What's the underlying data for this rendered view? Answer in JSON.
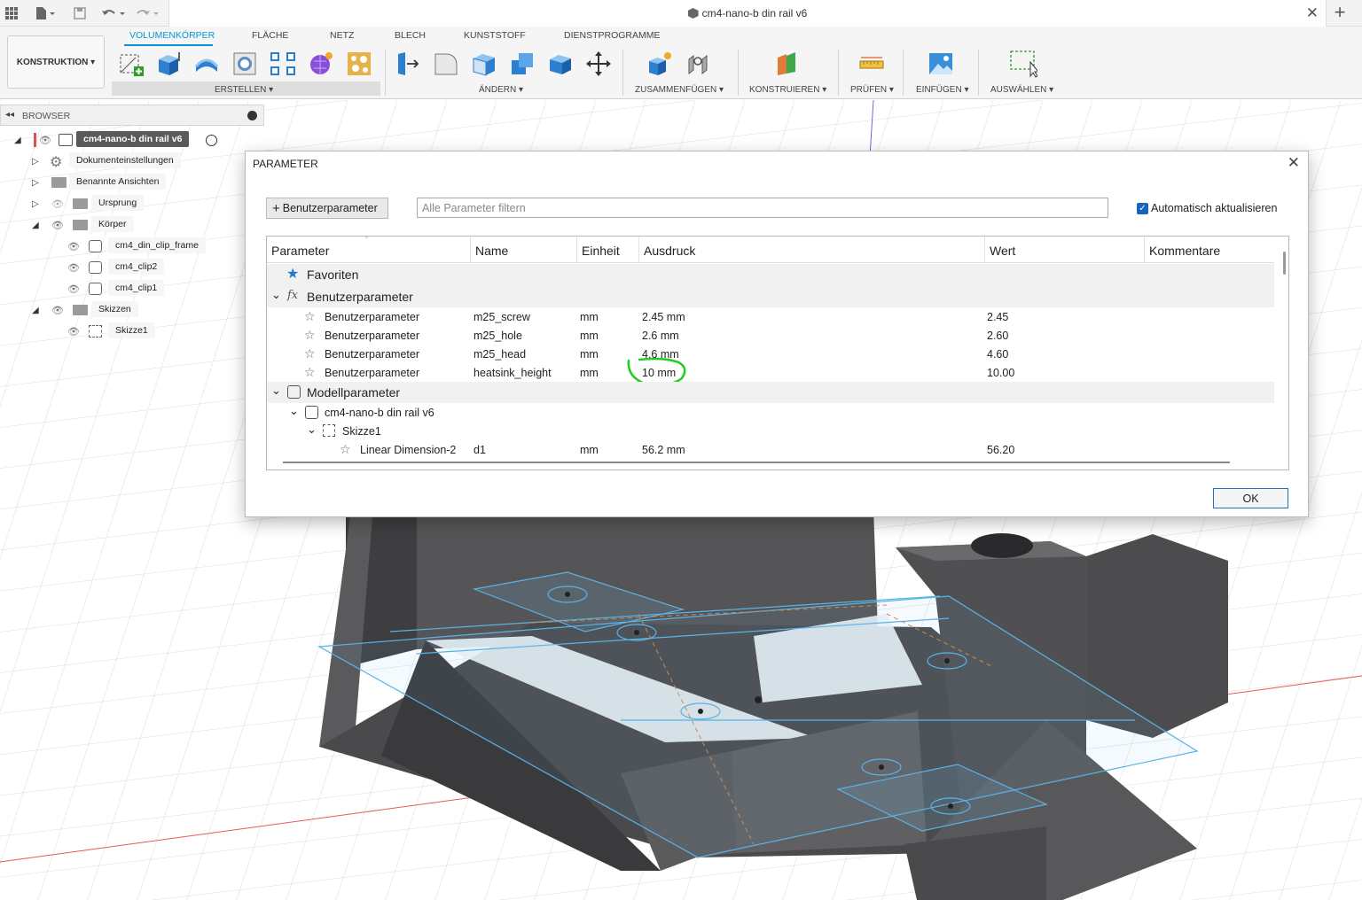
{
  "app": {
    "document_title": "cm4-nano-b din rail v6"
  },
  "ribbon": {
    "workspace": "KONSTRUKTION",
    "tabs": [
      "VOLUMENKÖRPER",
      "FLÄCHE",
      "NETZ",
      "BLECH",
      "KUNSTSTOFF",
      "DIENSTPROGRAMME"
    ],
    "groups": [
      "ERSTELLEN",
      "ÄNDERN",
      "ZUSAMMENFÜGEN",
      "KONSTRUIEREN",
      "PRÜFEN",
      "EINFÜGEN",
      "AUSWÄHLEN"
    ]
  },
  "browser": {
    "title": "BROWSER",
    "root": "cm4-nano-b din rail v6",
    "items": [
      "Dokumenteinstellungen",
      "Benannte Ansichten",
      "Ursprung",
      "Körper",
      "cm4_din_clip_frame",
      "cm4_clip2",
      "cm4_clip1",
      "Skizzen",
      "Skizze1"
    ]
  },
  "dialog": {
    "title": "PARAMETER",
    "add_button": "Benutzerparameter",
    "filter_placeholder": "Alle Parameter filtern",
    "auto_update": "Automatisch aktualisieren",
    "ok": "OK",
    "columns": [
      "Parameter",
      "Name",
      "Einheit",
      "Ausdruck",
      "Wert",
      "Kommentare"
    ],
    "sections": {
      "favorites": "Favoriten",
      "user": "Benutzerparameter",
      "model": "Modellparameter"
    },
    "user_params": [
      {
        "type": "Benutzerparameter",
        "name": "m25_screw",
        "unit": "mm",
        "expr": "2.45 mm",
        "value": "2.45"
      },
      {
        "type": "Benutzerparameter",
        "name": "m25_hole",
        "unit": "mm",
        "expr": "2.6 mm",
        "value": "2.60"
      },
      {
        "type": "Benutzerparameter",
        "name": "m25_head",
        "unit": "mm",
        "expr": "4.6 mm",
        "value": "4.60"
      },
      {
        "type": "Benutzerparameter",
        "name": "heatsink_height",
        "unit": "mm",
        "expr": "10 mm",
        "value": "10.00"
      }
    ],
    "model": {
      "component": "cm4-nano-b din rail v6",
      "sketch": "Skizze1",
      "dimension": {
        "type": "Linear Dimension-2",
        "name": "d1",
        "unit": "mm",
        "expr": "56.2 mm",
        "value": "56.20"
      }
    }
  },
  "colors": {
    "accent": "#0696d7",
    "highlight_circle": "#22cc22",
    "model_body": "#4a4a4c"
  }
}
